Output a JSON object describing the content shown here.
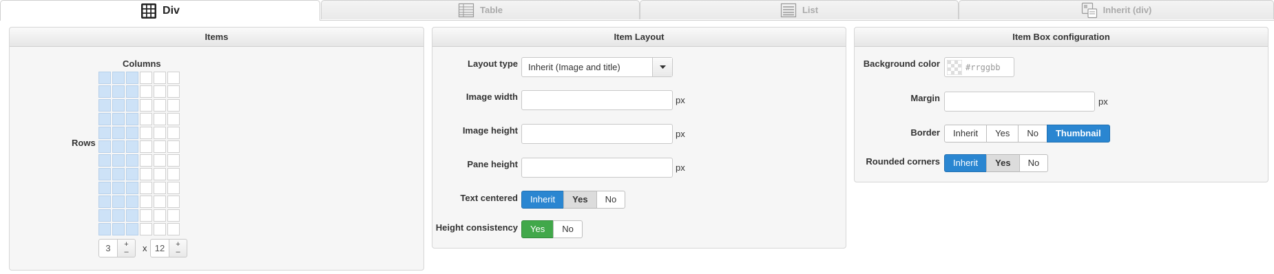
{
  "tabs": [
    {
      "label": "Div",
      "icon": "div-grid-icon",
      "active": true
    },
    {
      "label": "Table",
      "icon": "table-icon",
      "active": false
    },
    {
      "label": "List",
      "icon": "list-icon",
      "active": false
    },
    {
      "label": "Inherit (div)",
      "icon": "inherit-icon",
      "active": false
    }
  ],
  "items": {
    "title": "Items",
    "columns_label": "Columns",
    "rows_label": "Rows",
    "columns_total": 6,
    "rows_total": 12,
    "columns_value": "3",
    "times": "x",
    "rows_value": "12",
    "plus": "+",
    "minus": "–"
  },
  "layout": {
    "title": "Item Layout",
    "layout_type_label": "Layout type",
    "layout_type_value": "Inherit (Image and title)",
    "image_width_label": "Image width",
    "image_height_label": "Image height",
    "pane_height_label": "Pane height",
    "unit": "px",
    "text_centered_label": "Text centered",
    "text_centered_options": [
      "Inherit",
      "Yes",
      "No"
    ],
    "height_consistency_label": "Height consistency",
    "height_consistency_options": [
      "Yes",
      "No"
    ]
  },
  "box": {
    "title": "Item Box configuration",
    "bg_color_label": "Background color",
    "bg_color_placeholder": "#rrggbb",
    "margin_label": "Margin",
    "unit": "px",
    "border_label": "Border",
    "border_options": [
      "Inherit",
      "Yes",
      "No",
      "Thumbnail"
    ],
    "rounded_label": "Rounded corners",
    "rounded_options": [
      "Inherit",
      "Yes",
      "No"
    ]
  },
  "colors": {
    "primary": "#2a86d1",
    "success": "#41a84a",
    "selected_cell": "#cde2f7"
  }
}
